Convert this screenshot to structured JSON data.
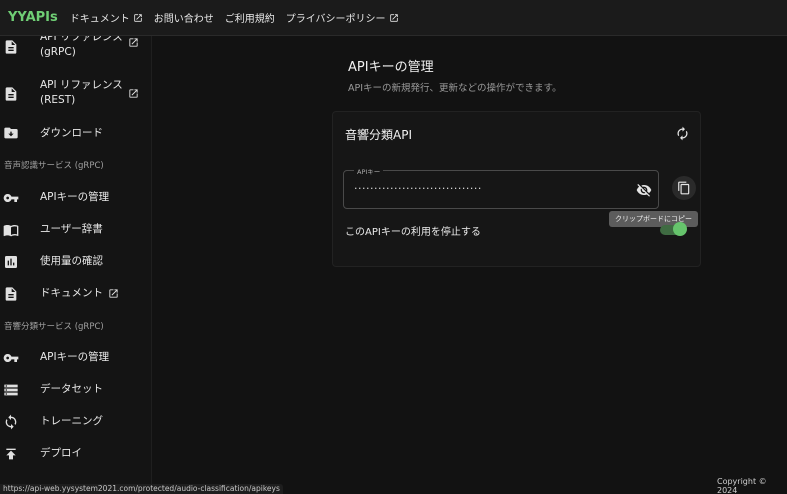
{
  "topbar": {
    "brand": "YYAPIs",
    "links": [
      {
        "label": "ドキュメント",
        "external": true
      },
      {
        "label": "お問い合わせ",
        "external": false
      },
      {
        "label": "ご利用規約",
        "external": false
      },
      {
        "label": "プライバシーポリシー",
        "external": true
      }
    ]
  },
  "sidebar": {
    "items": [
      {
        "label": "API リファレンス (gRPC)",
        "icon": "document-icon",
        "external": true
      },
      {
        "label": "API リファレンス (REST)",
        "icon": "document-icon",
        "external": true
      },
      {
        "label": "ダウンロード",
        "icon": "folder-download-icon",
        "external": false
      }
    ],
    "section_speech": "音声認識サービス (gRPC)",
    "speech_items": [
      {
        "label": "APIキーの管理",
        "icon": "key-icon"
      },
      {
        "label": "ユーザー辞書",
        "icon": "book-icon"
      },
      {
        "label": "使用量の確認",
        "icon": "chart-icon"
      },
      {
        "label": "ドキュメント",
        "icon": "document-icon",
        "external": true
      }
    ],
    "section_audio": "音響分類サービス (gRPC)",
    "audio_items": [
      {
        "label": "APIキーの管理",
        "icon": "key-icon"
      },
      {
        "label": "データセット",
        "icon": "dataset-icon"
      },
      {
        "label": "トレーニング",
        "icon": "training-icon"
      },
      {
        "label": "デプロイ",
        "icon": "deploy-icon"
      }
    ]
  },
  "main": {
    "title": "APIキーの管理",
    "subtitle": "APIキーの新規発行、更新などの操作ができます。",
    "card": {
      "title": "音響分類API",
      "key_label": "APIキー",
      "key_value": "································",
      "copy_tooltip": "クリップボードにコピー",
      "stop_label": "このAPIキーの利用を停止する",
      "stop_enabled": true,
      "accent": "#66c46c"
    }
  },
  "status_url": "https://api-web.yysystem2021.com/protected/audio-classification/apikeys",
  "copyright": "Copyright © 2024"
}
